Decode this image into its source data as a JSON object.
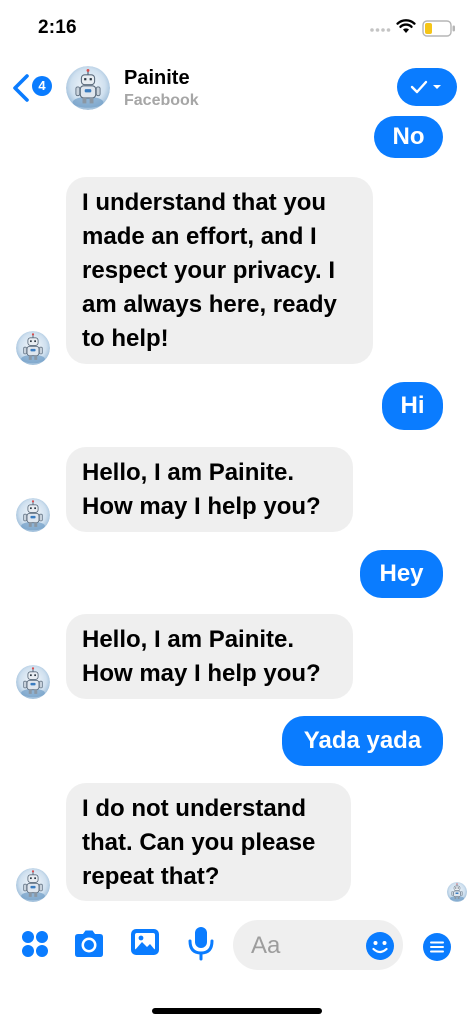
{
  "status": {
    "time": "2:16"
  },
  "header": {
    "unread_count": "4",
    "contact_name": "Painite",
    "contact_source": "Facebook"
  },
  "messages": [
    {
      "from": "me",
      "text": "No"
    },
    {
      "from": "bot",
      "text": "I understand that you made an effort, and I respect your privacy. I am always here, ready to help!"
    },
    {
      "from": "me",
      "text": "Hi"
    },
    {
      "from": "bot",
      "text": "Hello, I am Painite. How may I help you?"
    },
    {
      "from": "me",
      "text": "Hey"
    },
    {
      "from": "bot",
      "text": "Hello, I am Painite. How may I help you?"
    },
    {
      "from": "me",
      "text": "Yada yada"
    },
    {
      "from": "bot",
      "text": "I do not understand that. Can you please repeat that?"
    }
  ],
  "composer": {
    "placeholder": "Aa"
  },
  "colors": {
    "accent": "#0a7cff",
    "incoming_bubble": "#efefef",
    "muted": "#a6a6a6"
  },
  "icons": [
    "back-chevron-icon",
    "check-dropdown-icon",
    "apps-grid-icon",
    "camera-icon",
    "photo-icon",
    "microphone-icon",
    "emoji-icon",
    "menu-icon",
    "signal-icon",
    "wifi-icon",
    "battery-icon"
  ]
}
